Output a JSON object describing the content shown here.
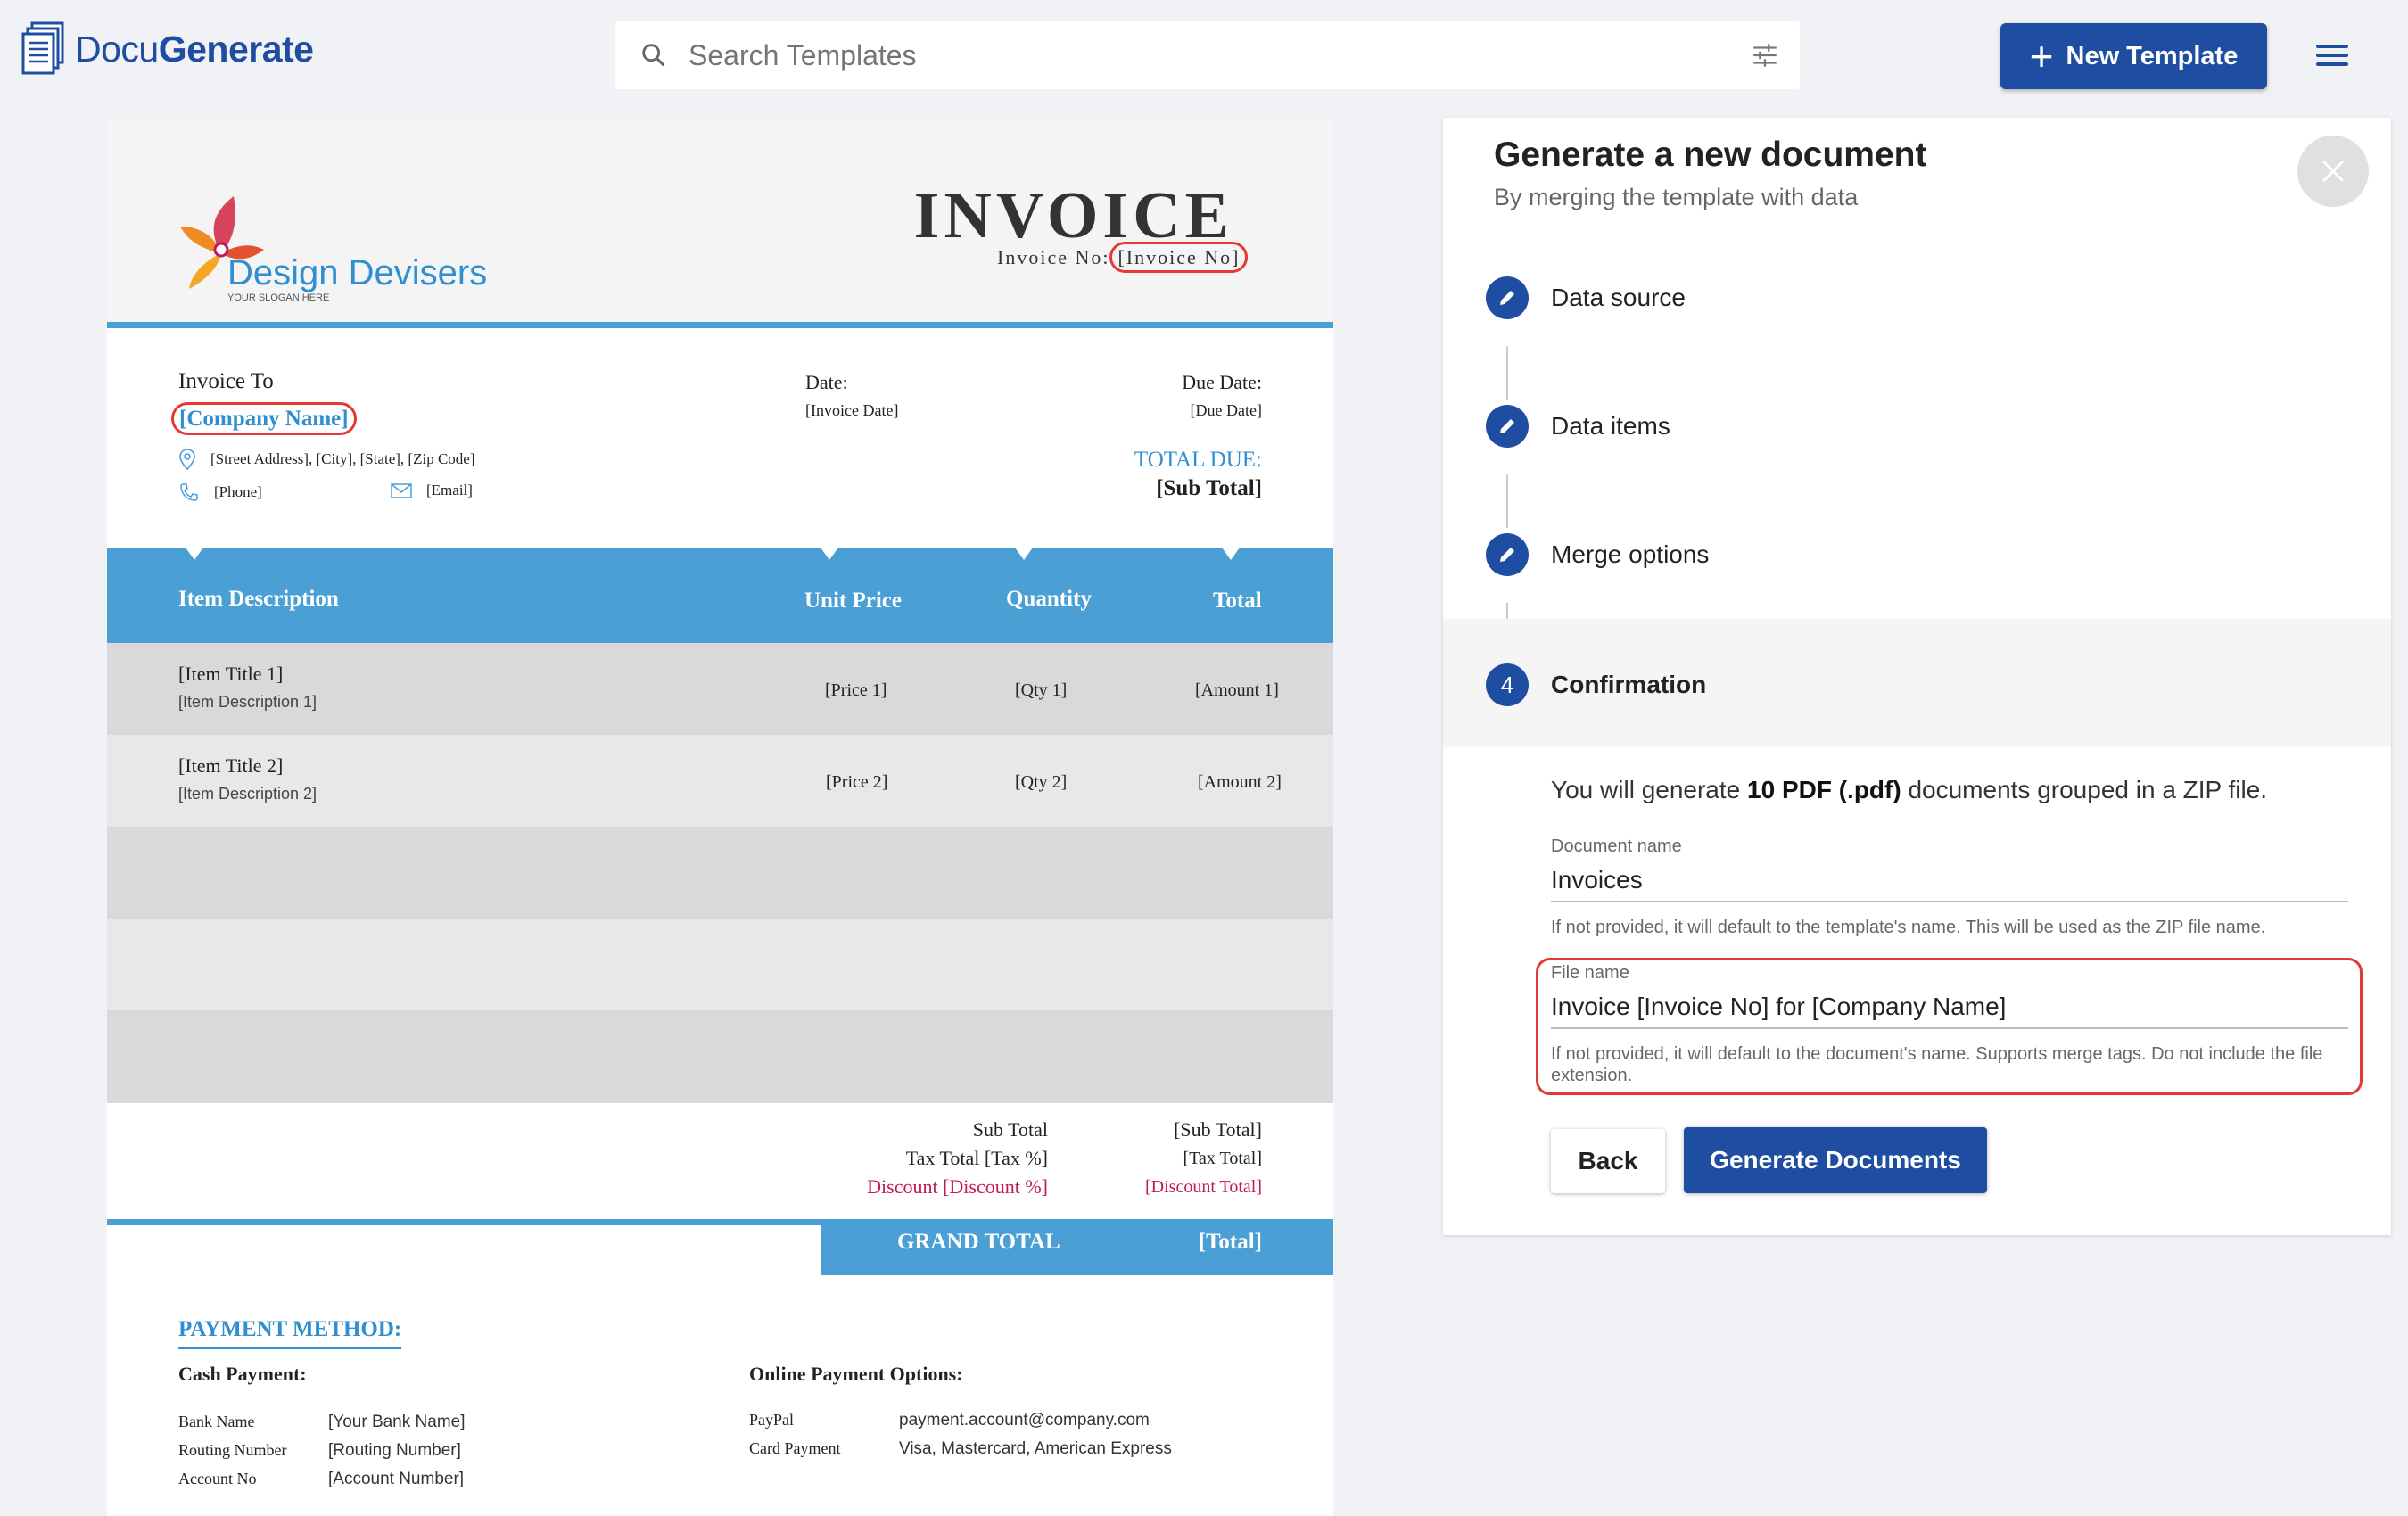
{
  "app": {
    "logo_light": "Docu",
    "logo_bold": "Generate"
  },
  "search": {
    "placeholder": "Search Templates"
  },
  "toolbar": {
    "new_template_label": "New Template"
  },
  "invoice": {
    "brand_name": "Design Devisers",
    "brand_slogan": "YOUR SLOGAN HERE",
    "title": "INVOICE",
    "invoice_no_label": "Invoice No:",
    "invoice_no_value": "[Invoice No]",
    "invoice_to_label": "Invoice To",
    "company": "[Company Name]",
    "address": "[Street Address], [City], [State], [Zip Code]",
    "phone": "[Phone]",
    "email": "[Email]",
    "date_label": "Date:",
    "date_value": "[Invoice Date]",
    "due_label": "Due Date:",
    "due_value": "[Due Date]",
    "total_due_label": "TOTAL DUE:",
    "total_due_value": "[Sub Total]",
    "columns": {
      "description": "Item Description",
      "unit_price": "Unit Price",
      "quantity": "Quantity",
      "total": "Total"
    },
    "items": [
      {
        "title": "[Item Title 1]",
        "description": "[Item Description 1]",
        "price": "[Price 1]",
        "qty": "[Qty 1]",
        "amount": "[Amount 1]"
      },
      {
        "title": "[Item Title 2]",
        "description": "[Item Description 2]",
        "price": "[Price 2]",
        "qty": "[Qty 2]",
        "amount": "[Amount 2]"
      }
    ],
    "sub_total_label": "Sub Total",
    "sub_total_value": "[Sub Total]",
    "tax_label": "Tax Total [Tax  %]",
    "tax_value": "[Tax Total]",
    "discount_label": "Discount [Discount %]",
    "discount_value": "[Discount Total]",
    "grand_total_label": "GRAND TOTAL",
    "grand_total_value": "[Total]",
    "payment_title": "PAYMENT METHOD:",
    "cash_title": "Cash Payment:",
    "bank_name_label": "Bank Name",
    "bank_name_value": "[Your Bank Name]",
    "routing_label": "Routing Number",
    "routing_value": "[Routing Number]",
    "account_label": "Account No",
    "account_value": "[Account Number]",
    "online_title": "Online Payment Options:",
    "paypal_label": "PayPal",
    "paypal_value": "payment.account@company.com",
    "card_label": "Card Payment",
    "card_value": "Visa, Mastercard, American Express"
  },
  "panel": {
    "title": "Generate a new document",
    "subtitle": "By merging the template with data",
    "steps": [
      {
        "label": "Data source",
        "icon": "pencil-icon"
      },
      {
        "label": "Data items",
        "icon": "pencil-icon"
      },
      {
        "label": "Merge options",
        "icon": "pencil-icon"
      },
      {
        "label": "Confirmation",
        "number": "4"
      }
    ],
    "info_prefix": "You will generate ",
    "info_bold": "10 PDF (.pdf)",
    "info_suffix": " documents grouped in a ZIP file.",
    "document_name_label": "Document name",
    "document_name_value": "Invoices",
    "document_name_help": "If not provided, it will default to the template's name. This will be used as the ZIP file name.",
    "file_name_label": "File name",
    "file_name_value": "Invoice [Invoice No] for [Company Name]",
    "file_name_help": "If not provided, it will default to the document's name. Supports merge tags. Do not include the file extension.",
    "back_label": "Back",
    "generate_label": "Generate Documents"
  },
  "colors": {
    "brand_blue": "#1e4da1",
    "invoice_blue": "#4a9fd5",
    "highlight_red": "#e53935",
    "discount_red": "#c2185b"
  }
}
